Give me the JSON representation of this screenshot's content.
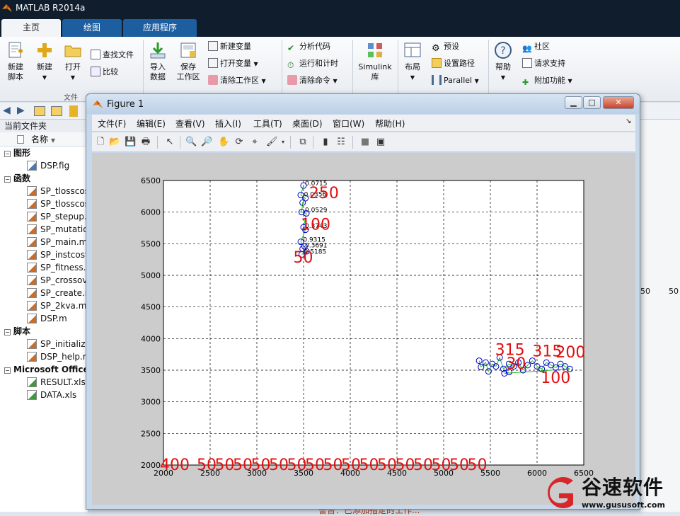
{
  "app": {
    "title": "MATLAB R2014a"
  },
  "ribbon_tabs": [
    "主页",
    "绘图",
    "应用程序"
  ],
  "ribbon": {
    "new_script": "新建\n脚本",
    "new": "新建",
    "open": "打开",
    "find_files": "查找文件",
    "compare": "比较",
    "file_group": "文件",
    "import_data": "导入\n数据",
    "save_workspace": "保存\n工作区",
    "new_variable": "新建变量",
    "open_variable": "打开变量",
    "clear_workspace": "清除工作区",
    "analyze_code": "分析代码",
    "run_and_time": "运行和计时",
    "clear_commands": "清除命令",
    "simulink": "Simulink\n库",
    "layout": "布局",
    "preferences": "预设",
    "set_path": "设置路径",
    "parallel": "Parallel",
    "help": "帮助",
    "community": "社区",
    "request_support": "请求支持",
    "add_ons": "附加功能"
  },
  "current_folder": {
    "header": "当前文件夹",
    "name_column": "名称",
    "sections": [
      {
        "label": "图形",
        "items": [
          "DSP.fig"
        ]
      },
      {
        "label": "函数",
        "items": [
          "SP_tlosscos",
          "SP_tlosscos",
          "SP_stepup.",
          "SP_mutatio",
          "SP_main.m",
          "SP_instcost",
          "SP_fitness.r",
          "SP_crossov",
          "SP_create.r",
          "SP_2kva.m",
          "DSP.m"
        ]
      },
      {
        "label": "脚本",
        "items": [
          "SP_initialize",
          "DSP_help.m"
        ]
      },
      {
        "label": "Microsoft Office",
        "items": [
          "RESULT.xls",
          "DATA.xls"
        ]
      }
    ]
  },
  "right_strip": {
    "text_a": "50",
    "text_b": "50"
  },
  "bottom_text": "警告：已添加指定的工作...",
  "figure": {
    "title": "Figure 1",
    "menus": [
      "文件(F)",
      "编辑(E)",
      "查看(V)",
      "插入(I)",
      "工具(T)",
      "桌面(D)",
      "窗口(W)",
      "帮助(H)"
    ]
  },
  "chart_data": {
    "type": "scatter",
    "title": "",
    "xlabel": "",
    "ylabel": "",
    "xlim": [
      2000,
      6500
    ],
    "ylim": [
      2000,
      6500
    ],
    "x_ticks": [
      "2000",
      "2500",
      "3000",
      "3500",
      "4000",
      "4500",
      "5000",
      "5500",
      "6000",
      "6500"
    ],
    "y_ticks": [
      "2000",
      "2500",
      "3000",
      "3500",
      "4000",
      "4500",
      "5000",
      "5500",
      "6000",
      "6500"
    ],
    "grid": true,
    "cluster_a": {
      "points": [
        [
          3500,
          6420
        ],
        [
          3470,
          6270
        ],
        [
          3520,
          6220
        ],
        [
          3490,
          6150
        ],
        [
          3480,
          6000
        ],
        [
          3530,
          5980
        ],
        [
          3500,
          5760
        ],
        [
          3520,
          5720
        ],
        [
          3470,
          5530
        ],
        [
          3510,
          5460
        ],
        [
          3490,
          5420
        ],
        [
          3530,
          5380
        ],
        [
          3480,
          5330
        ]
      ],
      "labels": [
        {
          "text": "0.0715",
          "x": 3500,
          "y": 6420
        },
        {
          "text": "0.0356",
          "x": 3490,
          "y": 6250
        },
        {
          "text": "0.0529",
          "x": 3500,
          "y": 6000
        },
        {
          "text": "0.3743",
          "x": 3500,
          "y": 5750
        },
        {
          "text": "0.9315",
          "x": 3480,
          "y": 5530
        },
        {
          "text": "0.3691",
          "x": 3500,
          "y": 5440
        },
        {
          "text": "0.5185",
          "x": 3490,
          "y": 5340
        }
      ],
      "big_labels": [
        {
          "text": "250",
          "x": 3560,
          "y": 6220
        },
        {
          "text": "100",
          "x": 3470,
          "y": 5720
        },
        {
          "text": "50",
          "x": 3390,
          "y": 5200
        }
      ]
    },
    "cluster_b": {
      "points": [
        [
          5380,
          3650
        ],
        [
          5400,
          3550
        ],
        [
          5450,
          3620
        ],
        [
          5480,
          3480
        ],
        [
          5520,
          3600
        ],
        [
          5560,
          3560
        ],
        [
          5600,
          3700
        ],
        [
          5640,
          3520
        ],
        [
          5700,
          3600
        ],
        [
          5750,
          3560
        ],
        [
          5800,
          3620
        ],
        [
          5850,
          3500
        ],
        [
          5900,
          3580
        ],
        [
          5950,
          3650
        ],
        [
          6000,
          3560
        ],
        [
          6050,
          3520
        ],
        [
          6100,
          3620
        ],
        [
          6150,
          3580
        ],
        [
          6200,
          3540
        ],
        [
          6250,
          3600
        ],
        [
          6300,
          3560
        ],
        [
          6350,
          3520
        ],
        [
          5650,
          3450
        ],
        [
          5700,
          3470
        ]
      ],
      "big_labels": [
        {
          "text": "315",
          "x": 5550,
          "y": 3740
        },
        {
          "text": "315",
          "x": 5950,
          "y": 3720
        },
        {
          "text": "200",
          "x": 6200,
          "y": 3700
        },
        {
          "text": "30",
          "x": 5670,
          "y": 3520
        },
        {
          "text": "100",
          "x": 6040,
          "y": 3300
        }
      ]
    },
    "bottom_labels": [
      "400",
      "50",
      "50",
      "50",
      "50",
      "50",
      "50",
      "50",
      "50",
      "50",
      "50",
      "50",
      "50",
      "50",
      "50",
      "50",
      "50"
    ]
  },
  "watermark": {
    "name": "谷速软件",
    "url": "www.gususoft.com"
  },
  "colors": {
    "accent": "#1d5ea0",
    "label_red": "#e01010",
    "marker_blue": "#0000cc",
    "link_green": "#22bb22"
  }
}
